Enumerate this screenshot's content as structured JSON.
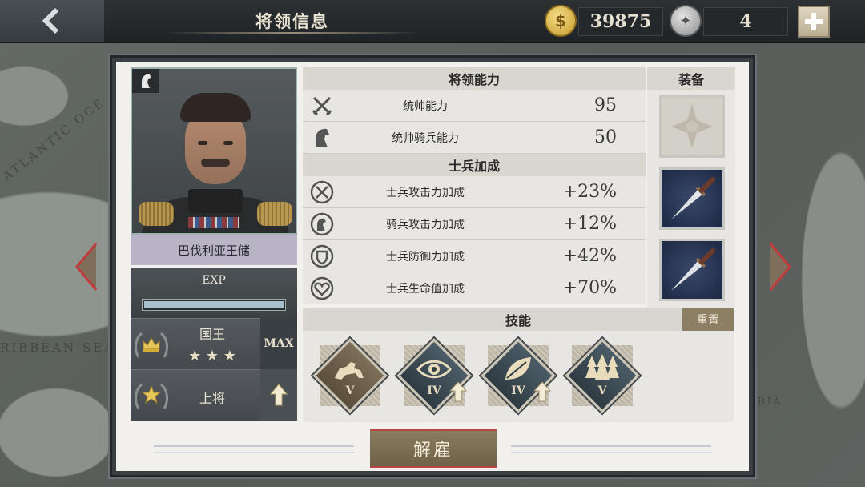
{
  "header": {
    "title": "将领信息",
    "gold": "39875",
    "medals": "4"
  },
  "general": {
    "name": "巴伐利亚王储",
    "exp_label": "EXP",
    "exp_progress": 1.0
  },
  "ranks": [
    {
      "title": "国王",
      "stars": "★ ★ ★",
      "side": "MAX"
    },
    {
      "title": "上将",
      "side": "up-arrow"
    }
  ],
  "abilities": {
    "section_title": "将领能力",
    "items": [
      {
        "name": "统帅能力",
        "value": "95",
        "icon": "crossed-swords-icon"
      },
      {
        "name": "统帅骑兵能力",
        "value": "50",
        "icon": "horse-head-icon"
      }
    ]
  },
  "bonuses": {
    "section_title": "士兵加成",
    "items": [
      {
        "name": "士兵攻击力加成",
        "value": "+23%",
        "icon": "attack-up-icon"
      },
      {
        "name": "骑兵攻击力加成",
        "value": "+12%",
        "icon": "cavalry-up-icon"
      },
      {
        "name": "士兵防御力加成",
        "value": "+42%",
        "icon": "shield-up-icon"
      },
      {
        "name": "士兵生命值加成",
        "value": "+70%",
        "icon": "heart-up-icon"
      }
    ]
  },
  "equipment": {
    "title": "装备"
  },
  "skills": {
    "title": "技能",
    "reset_label": "重置",
    "items": [
      {
        "level": "V",
        "icon": "cavalry-charge-icon",
        "upgradable": false
      },
      {
        "level": "IV",
        "icon": "eye-icon",
        "upgradable": true
      },
      {
        "level": "IV",
        "icon": "leaf-icon",
        "upgradable": true
      },
      {
        "level": "V",
        "icon": "forest-icon",
        "upgradable": false
      }
    ]
  },
  "footer": {
    "dismiss_label": "解雇"
  },
  "map_labels": [
    "ATLANTIC OCE",
    "RIBBEAN SEA",
    "BIA"
  ],
  "colors": {
    "accent_red": "#b44444",
    "panel_bg": "#f1f0ed",
    "gold": "#d8b548"
  }
}
